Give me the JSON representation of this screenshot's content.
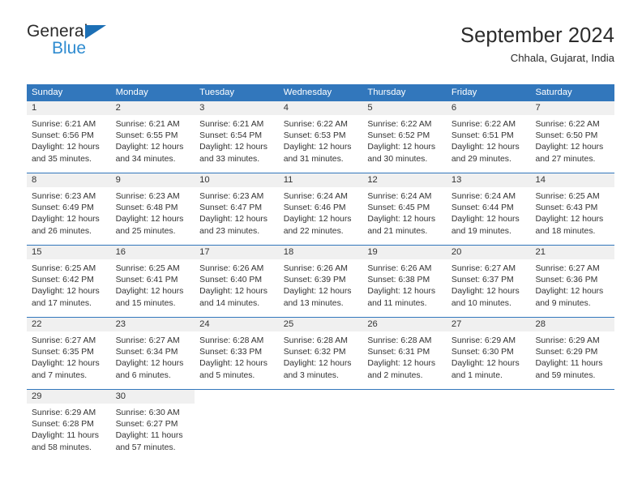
{
  "brand": {
    "name_part1": "General",
    "name_part2": "Blue",
    "accent_color": "#2e8bd0",
    "triangle_color": "#1c6fb5"
  },
  "header": {
    "title": "September 2024",
    "subtitle": "Chhala, Gujarat, India"
  },
  "theme": {
    "header_row_bg": "#3277bc",
    "header_row_text": "#ffffff",
    "daynum_band_bg": "#f0f0f0",
    "row_divider": "#3277bc",
    "text": "#333333"
  },
  "weekdays": [
    "Sunday",
    "Monday",
    "Tuesday",
    "Wednesday",
    "Thursday",
    "Friday",
    "Saturday"
  ],
  "weeks": [
    [
      {
        "day": "1",
        "sunrise": "Sunrise: 6:21 AM",
        "sunset": "Sunset: 6:56 PM",
        "daylight_line1": "Daylight: 12 hours",
        "daylight_line2": "and 35 minutes."
      },
      {
        "day": "2",
        "sunrise": "Sunrise: 6:21 AM",
        "sunset": "Sunset: 6:55 PM",
        "daylight_line1": "Daylight: 12 hours",
        "daylight_line2": "and 34 minutes."
      },
      {
        "day": "3",
        "sunrise": "Sunrise: 6:21 AM",
        "sunset": "Sunset: 6:54 PM",
        "daylight_line1": "Daylight: 12 hours",
        "daylight_line2": "and 33 minutes."
      },
      {
        "day": "4",
        "sunrise": "Sunrise: 6:22 AM",
        "sunset": "Sunset: 6:53 PM",
        "daylight_line1": "Daylight: 12 hours",
        "daylight_line2": "and 31 minutes."
      },
      {
        "day": "5",
        "sunrise": "Sunrise: 6:22 AM",
        "sunset": "Sunset: 6:52 PM",
        "daylight_line1": "Daylight: 12 hours",
        "daylight_line2": "and 30 minutes."
      },
      {
        "day": "6",
        "sunrise": "Sunrise: 6:22 AM",
        "sunset": "Sunset: 6:51 PM",
        "daylight_line1": "Daylight: 12 hours",
        "daylight_line2": "and 29 minutes."
      },
      {
        "day": "7",
        "sunrise": "Sunrise: 6:22 AM",
        "sunset": "Sunset: 6:50 PM",
        "daylight_line1": "Daylight: 12 hours",
        "daylight_line2": "and 27 minutes."
      }
    ],
    [
      {
        "day": "8",
        "sunrise": "Sunrise: 6:23 AM",
        "sunset": "Sunset: 6:49 PM",
        "daylight_line1": "Daylight: 12 hours",
        "daylight_line2": "and 26 minutes."
      },
      {
        "day": "9",
        "sunrise": "Sunrise: 6:23 AM",
        "sunset": "Sunset: 6:48 PM",
        "daylight_line1": "Daylight: 12 hours",
        "daylight_line2": "and 25 minutes."
      },
      {
        "day": "10",
        "sunrise": "Sunrise: 6:23 AM",
        "sunset": "Sunset: 6:47 PM",
        "daylight_line1": "Daylight: 12 hours",
        "daylight_line2": "and 23 minutes."
      },
      {
        "day": "11",
        "sunrise": "Sunrise: 6:24 AM",
        "sunset": "Sunset: 6:46 PM",
        "daylight_line1": "Daylight: 12 hours",
        "daylight_line2": "and 22 minutes."
      },
      {
        "day": "12",
        "sunrise": "Sunrise: 6:24 AM",
        "sunset": "Sunset: 6:45 PM",
        "daylight_line1": "Daylight: 12 hours",
        "daylight_line2": "and 21 minutes."
      },
      {
        "day": "13",
        "sunrise": "Sunrise: 6:24 AM",
        "sunset": "Sunset: 6:44 PM",
        "daylight_line1": "Daylight: 12 hours",
        "daylight_line2": "and 19 minutes."
      },
      {
        "day": "14",
        "sunrise": "Sunrise: 6:25 AM",
        "sunset": "Sunset: 6:43 PM",
        "daylight_line1": "Daylight: 12 hours",
        "daylight_line2": "and 18 minutes."
      }
    ],
    [
      {
        "day": "15",
        "sunrise": "Sunrise: 6:25 AM",
        "sunset": "Sunset: 6:42 PM",
        "daylight_line1": "Daylight: 12 hours",
        "daylight_line2": "and 17 minutes."
      },
      {
        "day": "16",
        "sunrise": "Sunrise: 6:25 AM",
        "sunset": "Sunset: 6:41 PM",
        "daylight_line1": "Daylight: 12 hours",
        "daylight_line2": "and 15 minutes."
      },
      {
        "day": "17",
        "sunrise": "Sunrise: 6:26 AM",
        "sunset": "Sunset: 6:40 PM",
        "daylight_line1": "Daylight: 12 hours",
        "daylight_line2": "and 14 minutes."
      },
      {
        "day": "18",
        "sunrise": "Sunrise: 6:26 AM",
        "sunset": "Sunset: 6:39 PM",
        "daylight_line1": "Daylight: 12 hours",
        "daylight_line2": "and 13 minutes."
      },
      {
        "day": "19",
        "sunrise": "Sunrise: 6:26 AM",
        "sunset": "Sunset: 6:38 PM",
        "daylight_line1": "Daylight: 12 hours",
        "daylight_line2": "and 11 minutes."
      },
      {
        "day": "20",
        "sunrise": "Sunrise: 6:27 AM",
        "sunset": "Sunset: 6:37 PM",
        "daylight_line1": "Daylight: 12 hours",
        "daylight_line2": "and 10 minutes."
      },
      {
        "day": "21",
        "sunrise": "Sunrise: 6:27 AM",
        "sunset": "Sunset: 6:36 PM",
        "daylight_line1": "Daylight: 12 hours",
        "daylight_line2": "and 9 minutes."
      }
    ],
    [
      {
        "day": "22",
        "sunrise": "Sunrise: 6:27 AM",
        "sunset": "Sunset: 6:35 PM",
        "daylight_line1": "Daylight: 12 hours",
        "daylight_line2": "and 7 minutes."
      },
      {
        "day": "23",
        "sunrise": "Sunrise: 6:27 AM",
        "sunset": "Sunset: 6:34 PM",
        "daylight_line1": "Daylight: 12 hours",
        "daylight_line2": "and 6 minutes."
      },
      {
        "day": "24",
        "sunrise": "Sunrise: 6:28 AM",
        "sunset": "Sunset: 6:33 PM",
        "daylight_line1": "Daylight: 12 hours",
        "daylight_line2": "and 5 minutes."
      },
      {
        "day": "25",
        "sunrise": "Sunrise: 6:28 AM",
        "sunset": "Sunset: 6:32 PM",
        "daylight_line1": "Daylight: 12 hours",
        "daylight_line2": "and 3 minutes."
      },
      {
        "day": "26",
        "sunrise": "Sunrise: 6:28 AM",
        "sunset": "Sunset: 6:31 PM",
        "daylight_line1": "Daylight: 12 hours",
        "daylight_line2": "and 2 minutes."
      },
      {
        "day": "27",
        "sunrise": "Sunrise: 6:29 AM",
        "sunset": "Sunset: 6:30 PM",
        "daylight_line1": "Daylight: 12 hours",
        "daylight_line2": "and 1 minute."
      },
      {
        "day": "28",
        "sunrise": "Sunrise: 6:29 AM",
        "sunset": "Sunset: 6:29 PM",
        "daylight_line1": "Daylight: 11 hours",
        "daylight_line2": "and 59 minutes."
      }
    ],
    [
      {
        "day": "29",
        "sunrise": "Sunrise: 6:29 AM",
        "sunset": "Sunset: 6:28 PM",
        "daylight_line1": "Daylight: 11 hours",
        "daylight_line2": "and 58 minutes."
      },
      {
        "day": "30",
        "sunrise": "Sunrise: 6:30 AM",
        "sunset": "Sunset: 6:27 PM",
        "daylight_line1": "Daylight: 11 hours",
        "daylight_line2": "and 57 minutes."
      },
      {
        "day": "",
        "sunrise": "",
        "sunset": "",
        "daylight_line1": "",
        "daylight_line2": ""
      },
      {
        "day": "",
        "sunrise": "",
        "sunset": "",
        "daylight_line1": "",
        "daylight_line2": ""
      },
      {
        "day": "",
        "sunrise": "",
        "sunset": "",
        "daylight_line1": "",
        "daylight_line2": ""
      },
      {
        "day": "",
        "sunrise": "",
        "sunset": "",
        "daylight_line1": "",
        "daylight_line2": ""
      },
      {
        "day": "",
        "sunrise": "",
        "sunset": "",
        "daylight_line1": "",
        "daylight_line2": ""
      }
    ]
  ]
}
